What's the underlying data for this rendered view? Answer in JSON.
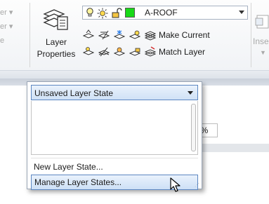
{
  "ribbon": {
    "left_faded_items": [
      "er ▾",
      "er ▾",
      "e"
    ],
    "layer_properties_label": [
      "Layer",
      "Properties"
    ],
    "layer_combo": {
      "current_layer": "A-ROOF",
      "color": "#18d918"
    },
    "tools": {
      "make_current": "Make Current",
      "match_layer": "Match Layer"
    },
    "insert_label": "Inse",
    "percent_text": "0%"
  },
  "layer_state_dropdown": {
    "selected": "Unsaved Layer State",
    "menu_items": [
      "New Layer State...",
      "Manage Layer States..."
    ],
    "highlighted_item": "Manage Layer States...",
    "accent_color": "#5b86c1"
  }
}
